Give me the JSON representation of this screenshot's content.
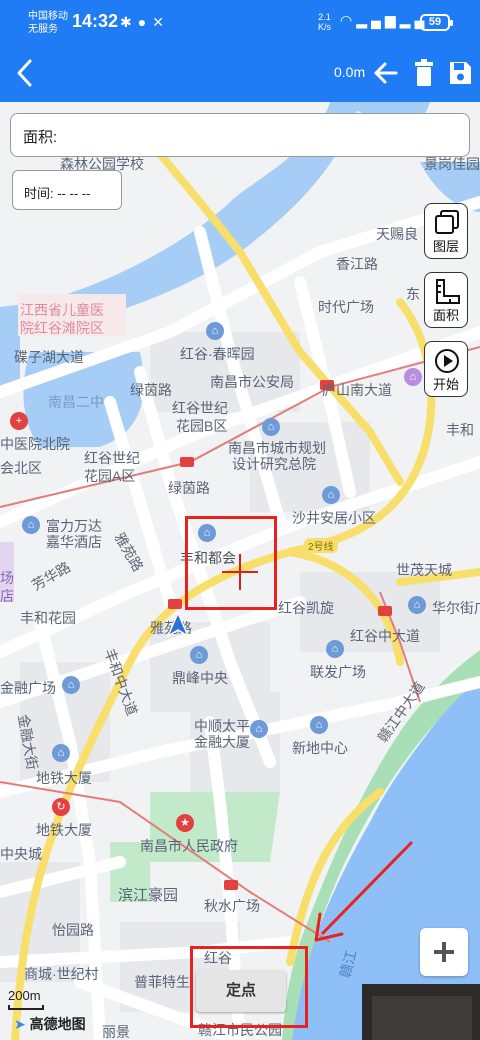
{
  "status_bar": {
    "carrier_line1": "中国移动",
    "carrier_line2": "无服务",
    "time": "14:32",
    "net_speed_value": "2.1",
    "net_speed_unit": "K/s",
    "battery": "59"
  },
  "toolbar": {
    "distance": "0.0m",
    "color": "#1f7cf4"
  },
  "info": {
    "area_label": "面积:",
    "time_label": "时间: -- -- --"
  },
  "side_buttons": {
    "layers": "图层",
    "area": "面积",
    "start": "开始"
  },
  "bottom": {
    "locate_button": "定点",
    "zoom_in": "+",
    "scale": "200m",
    "map_logo": "高德地图"
  },
  "map_labels": {
    "l1": "森林公园学校",
    "l2": "景岗佳园",
    "l3": "天赐良",
    "l4": "香江路",
    "l5": "时代广场",
    "l6": "东",
    "l7": "江西省儿童医",
    "l8": "院红谷滩院区",
    "l9": "碟子湖大道",
    "l10": "红谷·春晖园",
    "l11": "南昌二中",
    "l12": "绿茵路",
    "l13": "南昌市公安局",
    "l14": "庐山南大道",
    "l15": "红谷世纪",
    "l16": "花园B区",
    "l17": "丰和",
    "l18": "中医院北院",
    "l19": "南昌市城市规划",
    "l20": "设计研究总院",
    "l21": "会北区",
    "l22": "红谷世纪",
    "l23": "花园A区",
    "l24": "绿茵路",
    "l25": "沙井安居小区",
    "l26": "富力万达",
    "l27": "嘉华酒店",
    "l28": "雅苑路",
    "l29": "丰和都会",
    "l30": "2号线",
    "l31": "世茂天城",
    "l32": "场",
    "l33": "店",
    "l34": "芳华路",
    "l35": "丰和花园",
    "l36": "雅苑路",
    "l37": "红谷凯旋",
    "l38": "华尔街广",
    "l39": "红谷中大道",
    "l40": "丰和中大道",
    "l41": "鼎峰中央",
    "l42": "联发广场",
    "l43": "金融广场",
    "l44": "中顺太平",
    "l45": "金融大厦",
    "l46": "新地中心",
    "l47": "赣江中大道",
    "l48": "金融大街",
    "l49": "地铁大厦",
    "l50": "地铁大厦",
    "l51": "南昌市人民政府",
    "l52": "中央城",
    "l53": "滨江豪园",
    "l54": "秋水广场",
    "l55": "怡园路",
    "l56": "商城·世纪村",
    "l57": "普菲特生",
    "l58": "红谷",
    "l59": "赣江",
    "l60": "赣江市民公园",
    "l61": "丽景"
  }
}
